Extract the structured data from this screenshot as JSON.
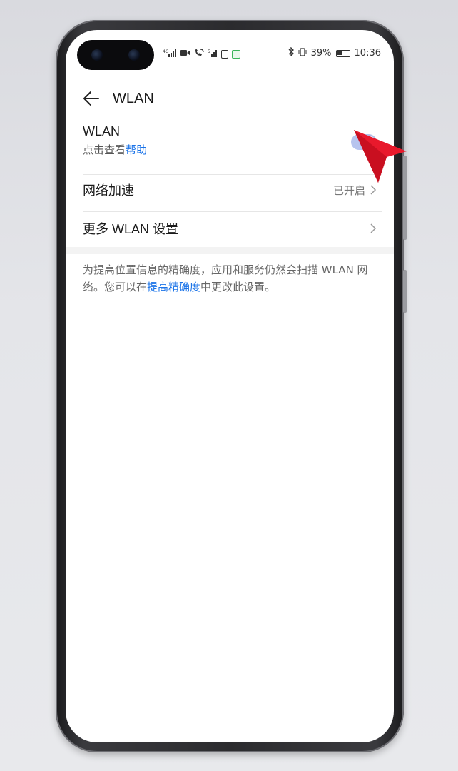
{
  "status_bar": {
    "left_icons": [
      "signal-hd-icon",
      "signal-bars-icon",
      "video-icon",
      "wifi-call-icon",
      "signal-icon",
      "battery-saver-icon",
      "green-sim-icon"
    ],
    "battery_percent": "39%",
    "time": "10:36"
  },
  "header": {
    "title": "WLAN"
  },
  "wlan": {
    "title": "WLAN",
    "sub_prefix": "点击查看",
    "sub_link": "帮助",
    "enabled": true
  },
  "network_accel": {
    "label": "网络加速",
    "value": "已开启"
  },
  "more_settings": {
    "label": "更多 WLAN 设置"
  },
  "note": {
    "text_before": "为提高位置信息的精确度，应用和服务仍然会扫描 WLAN 网络。您可以在",
    "link": "提高精确度",
    "text_after": "中更改此设置。"
  },
  "colors": {
    "accent": "#1a73e8",
    "toggle": "#b7c4ee",
    "pointer": "#e8192c"
  }
}
